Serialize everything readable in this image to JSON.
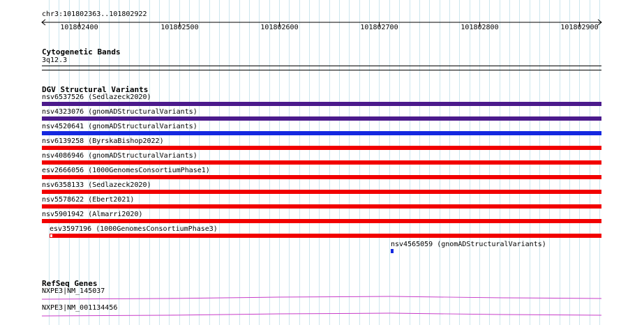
{
  "colors": {
    "grid": "#cce6ee",
    "purple": "#4b1a8c",
    "blue": "#1428e0",
    "red": "#f20000",
    "gene": "#c83cc8"
  },
  "ruler": {
    "location": "chr3:101802363..101802922",
    "start": 101802363,
    "end": 101802922,
    "ticks": [
      "101802400",
      "101802500",
      "101802600",
      "101802700",
      "101802800",
      "101802900"
    ]
  },
  "cytoband": {
    "title": "Cytogenetic Bands",
    "band": "3q12.3"
  },
  "dgv": {
    "title": "DGV Structural Variants",
    "features": [
      {
        "label": "nsv6537526 (Sedlazeck2020)",
        "color": "purple"
      },
      {
        "label": "nsv4323076 (gnomADStructuralVariants)",
        "color": "purple"
      },
      {
        "label": "nsv4520641 (gnomADStructuralVariants)",
        "color": "blue"
      },
      {
        "label": "nsv6139258 (ByrskaBishop2022)",
        "color": "red"
      },
      {
        "label": "nsv4086946 (gnomADStructuralVariants)",
        "color": "red"
      },
      {
        "label": "esv2666056 (1000GenomesConsortiumPhase1)",
        "color": "red"
      },
      {
        "label": "nsv6358133 (Sedlazeck2020)",
        "color": "red"
      },
      {
        "label": "nsv5578622 (Ebert2021)",
        "color": "red"
      },
      {
        "label": "nsv5901942 (Almarri2020)",
        "color": "red"
      },
      {
        "label": "esv3597196 (1000GenomesConsortiumPhase3)",
        "color": "red"
      },
      {
        "label": "nsv4565059 (gnomADStructuralVariants)",
        "color": "blue"
      }
    ]
  },
  "refseq": {
    "title": "RefSeq Genes",
    "genes": [
      {
        "label": "NXPE3|NM_145037"
      },
      {
        "label": "NXPE3|NM_001134456"
      }
    ]
  }
}
